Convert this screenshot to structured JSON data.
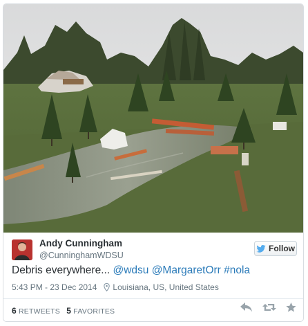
{
  "tweet": {
    "author_name": "Andy Cunningham",
    "author_handle": "@CunninghamWDSU",
    "follow_label": "Follow",
    "text_plain": "Debris everywhere... ",
    "mentions": [
      "@wdsu",
      "@MargaretOrr",
      "#nola"
    ],
    "time": "5:43 PM - 23 Dec 2014",
    "location": "Louisiana, US, United States",
    "retweets_count": "6",
    "retweets_label": "RETWEETS",
    "favorites_count": "5",
    "favorites_label": "FAVORITES"
  },
  "icons": {
    "bird": "twitter-bird-icon",
    "location": "location-pin-icon",
    "reply": "reply-icon",
    "retweet": "retweet-icon",
    "favorite": "star-icon"
  },
  "colors": {
    "link": "#2b7bb9",
    "text": "#292f33",
    "muted": "#66757f",
    "bird": "#55acee",
    "action_icon": "#99a4ab"
  }
}
